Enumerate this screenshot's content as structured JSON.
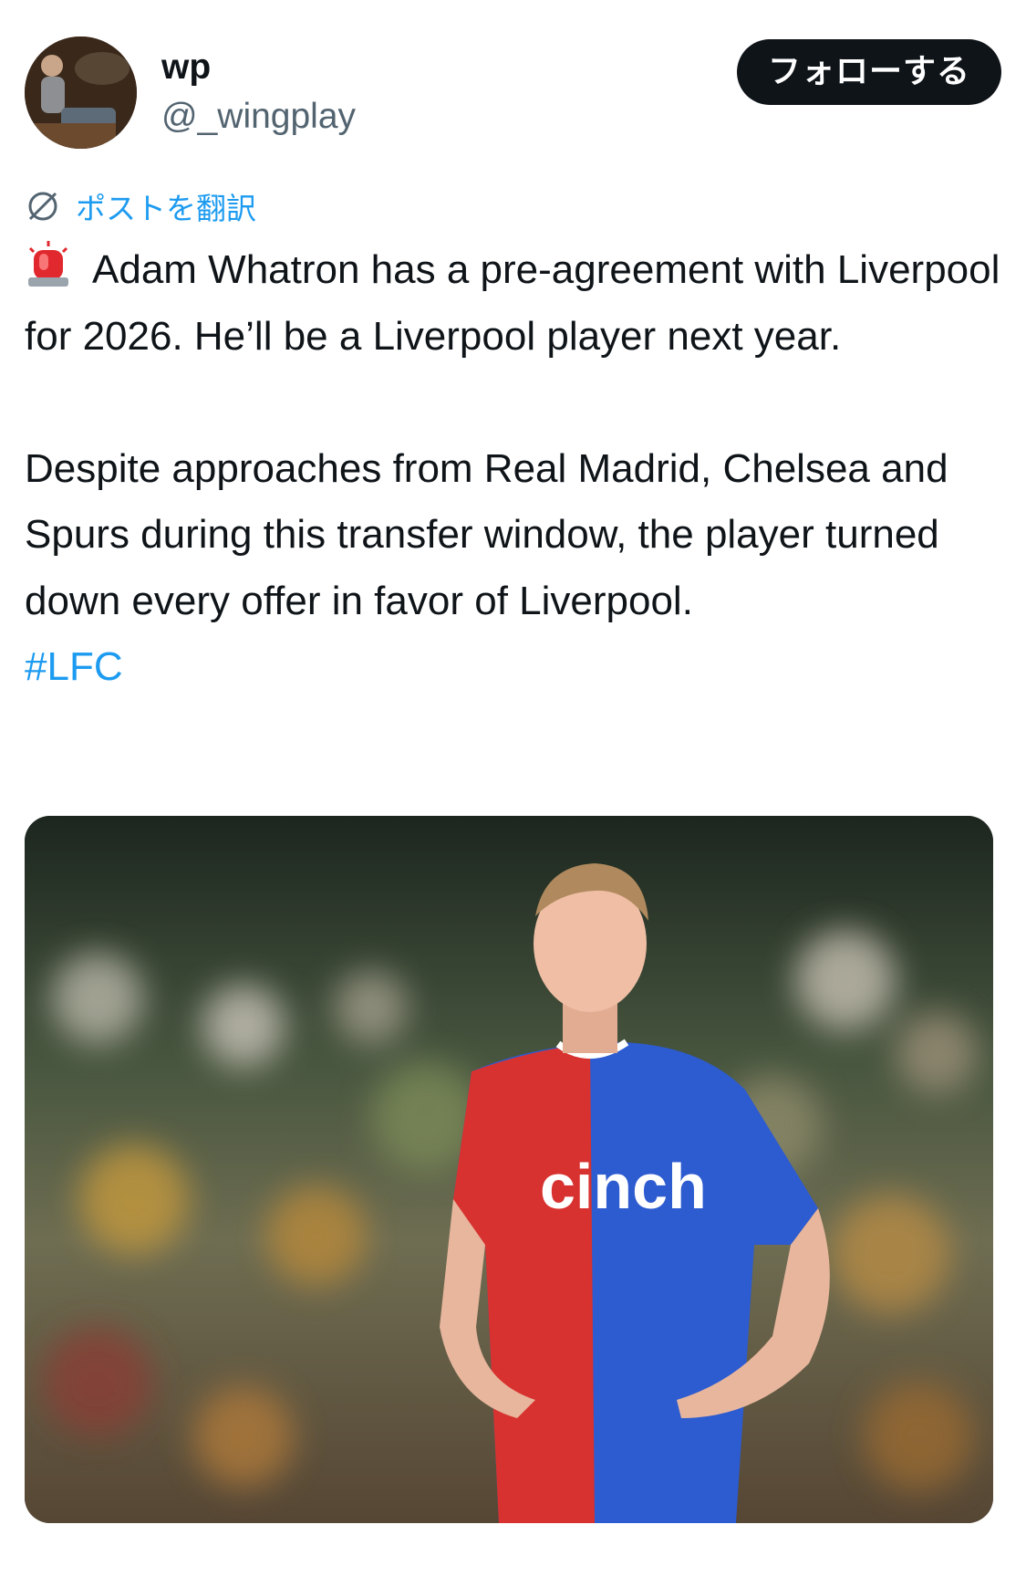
{
  "user": {
    "display_name": "wp",
    "handle": "@_wingplay",
    "follow_label": "フォローする"
  },
  "translate": {
    "label": "ポストを翻訳"
  },
  "tweet": {
    "paragraph_1": "Adam Whatron has a pre-agreement with Liverpool for 2026. He’ll be a Liverpool player next year.",
    "paragraph_2": "Despite approaches from Real Madrid, Chelsea and Spurs during this transfer window, the player turned down every offer in favor of Liverpool.",
    "hashtag": "#LFC",
    "leading_icon": "siren-icon"
  },
  "media": {
    "jersey_sponsor": "cinch"
  },
  "colors": {
    "link": "#1d9bf0",
    "follow_button_bg": "#0f1419",
    "secondary_text": "#536471"
  }
}
